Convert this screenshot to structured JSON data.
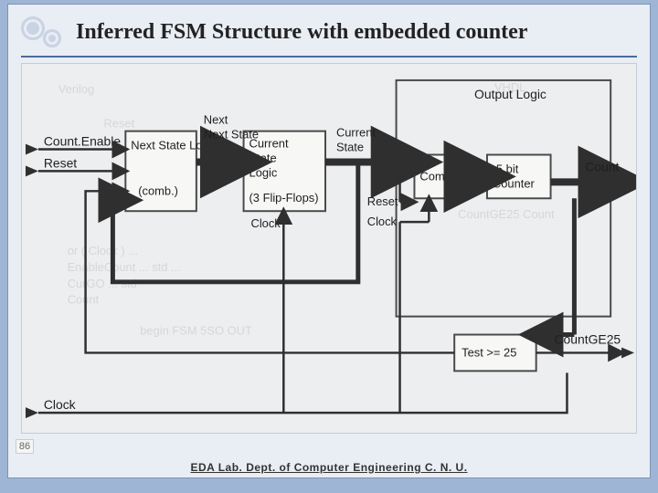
{
  "slide": {
    "title": "Inferred FSM Structure with embedded counter",
    "page_number": "86",
    "footer": "EDA Lab. Dept. of Computer Engineering C. N. U."
  },
  "diagram": {
    "inputs": {
      "count_enable": "Count.Enable",
      "reset": "Reset",
      "clock": "Clock"
    },
    "blocks": {
      "next_state": {
        "name": "Next State Logic",
        "subtitle": "(comb.)"
      },
      "current_state": {
        "name": "Current State Logic",
        "subtitle": "(3 Flip-Flops)"
      },
      "output_logic_title": "Output Logic",
      "comb": "Comb.",
      "counter": "5 bit Counter",
      "test": "Test >= 25"
    },
    "signals": {
      "next_state": "Next State",
      "current_state": "Current State",
      "clock": "Clock",
      "reset": "Reset",
      "count": "Count",
      "countge25": "CountGE25"
    }
  }
}
